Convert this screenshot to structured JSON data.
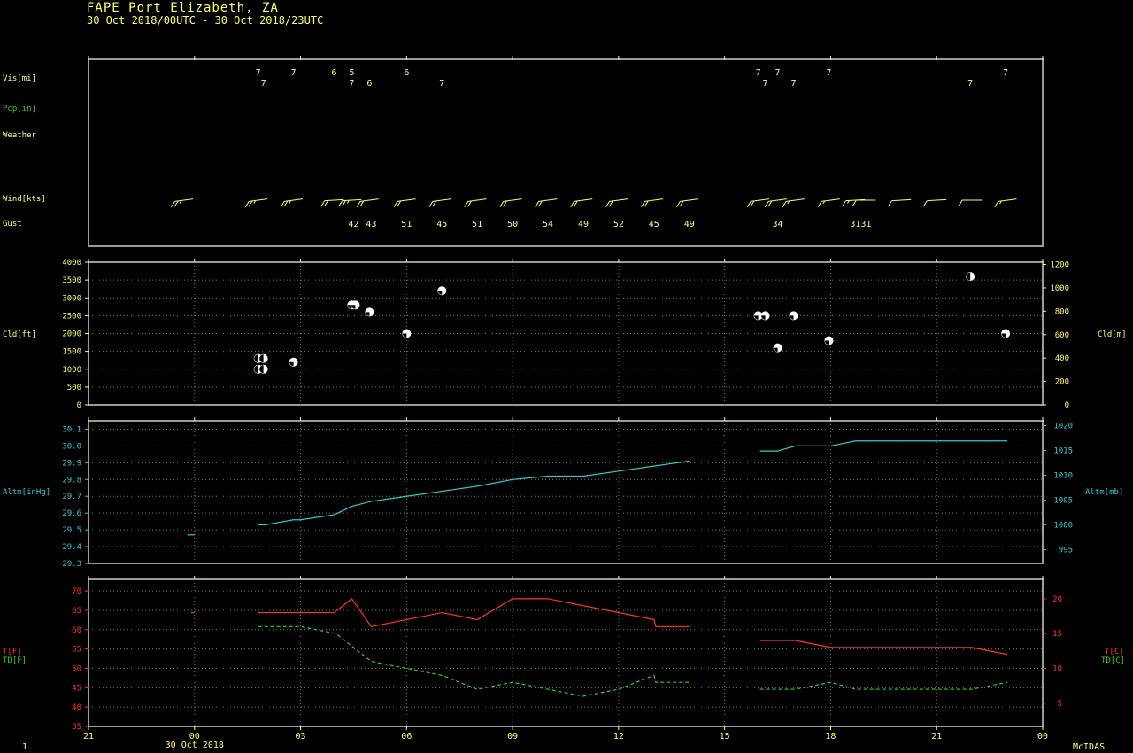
{
  "header": {
    "title": "FAPE  Port Elizabeth,  ZA",
    "subtitle": "30 Oct 2018/00UTC - 30 Oct 2018/23UTC"
  },
  "footer": {
    "left": "1",
    "right": "McIDAS"
  },
  "colors": {
    "yellow": "#ffff66",
    "cyan": "#33cccc",
    "red": "#ff3333",
    "green": "#33cc33",
    "frame": "#9a9a9a",
    "grid": "#777777"
  },
  "chart_data": [
    {
      "type": "table",
      "panel": "surface-obs",
      "row_labels": [
        "Vis[mi]",
        "Pcp[in]",
        "Weather",
        "Wind[kts]",
        "Gust"
      ],
      "visibility": [
        {
          "t": 1.8,
          "v": "7",
          "row": 0
        },
        {
          "t": 1.95,
          "v": "7",
          "row": 1
        },
        {
          "t": 2.8,
          "v": "7",
          "row": 0
        },
        {
          "t": 3.95,
          "v": "6",
          "row": 0
        },
        {
          "t": 4.45,
          "v": "5",
          "row": 0
        },
        {
          "t": 4.45,
          "v": "7",
          "row": 1
        },
        {
          "t": 4.95,
          "v": "6",
          "row": 1
        },
        {
          "t": 6.0,
          "v": "6",
          "row": 0
        },
        {
          "t": 7.0,
          "v": "7",
          "row": 1
        },
        {
          "t": 15.95,
          "v": "7",
          "row": 0
        },
        {
          "t": 16.15,
          "v": "7",
          "row": 1
        },
        {
          "t": 16.5,
          "v": "7",
          "row": 0
        },
        {
          "t": 16.95,
          "v": "7",
          "row": 1
        },
        {
          "t": 17.95,
          "v": "7",
          "row": 0
        },
        {
          "t": 21.95,
          "v": "7",
          "row": 1
        },
        {
          "t": 22.95,
          "v": "7",
          "row": 0
        }
      ],
      "wind": [
        {
          "t": -0.3,
          "dir": 250,
          "spd": 25
        },
        {
          "t": 1.8,
          "dir": 250,
          "spd": 25
        },
        {
          "t": 2.8,
          "dir": 250,
          "spd": 25
        },
        {
          "t": 3.95,
          "dir": 260,
          "spd": 20
        },
        {
          "t": 4.45,
          "dir": 260,
          "spd": 25
        },
        {
          "t": 4.95,
          "dir": 250,
          "spd": 20
        },
        {
          "t": 6.0,
          "dir": 250,
          "spd": 20
        },
        {
          "t": 7.0,
          "dir": 250,
          "spd": 20
        },
        {
          "t": 8.0,
          "dir": 250,
          "spd": 20
        },
        {
          "t": 9.0,
          "dir": 250,
          "spd": 20
        },
        {
          "t": 10.0,
          "dir": 250,
          "spd": 20
        },
        {
          "t": 11.0,
          "dir": 250,
          "spd": 20
        },
        {
          "t": 12.0,
          "dir": 250,
          "spd": 20
        },
        {
          "t": 13.0,
          "dir": 250,
          "spd": 20
        },
        {
          "t": 14.0,
          "dir": 250,
          "spd": 20
        },
        {
          "t": 16.0,
          "dir": 250,
          "spd": 20
        },
        {
          "t": 16.5,
          "dir": 250,
          "spd": 20
        },
        {
          "t": 17.0,
          "dir": 250,
          "spd": 15
        },
        {
          "t": 18.0,
          "dir": 250,
          "spd": 15
        },
        {
          "t": 18.7,
          "dir": 260,
          "spd": 15
        },
        {
          "t": 19.0,
          "dir": 270,
          "spd": 10
        },
        {
          "t": 20.0,
          "dir": 260,
          "spd": 10
        },
        {
          "t": 21.0,
          "dir": 260,
          "spd": 10
        },
        {
          "t": 22.0,
          "dir": 270,
          "spd": 10
        },
        {
          "t": 23.0,
          "dir": 250,
          "spd": 15
        }
      ],
      "gust": [
        {
          "t": 4.5,
          "v": "42"
        },
        {
          "t": 5.0,
          "v": "43"
        },
        {
          "t": 6.0,
          "v": "51"
        },
        {
          "t": 7.0,
          "v": "45"
        },
        {
          "t": 8.0,
          "v": "51"
        },
        {
          "t": 9.0,
          "v": "50"
        },
        {
          "t": 10.0,
          "v": "54"
        },
        {
          "t": 11.0,
          "v": "49"
        },
        {
          "t": 12.0,
          "v": "52"
        },
        {
          "t": 13.0,
          "v": "45"
        },
        {
          "t": 14.0,
          "v": "49"
        },
        {
          "t": 16.5,
          "v": "34"
        },
        {
          "t": 18.85,
          "v": "3131"
        }
      ]
    },
    {
      "type": "scatter",
      "panel": "cloud",
      "ylabel": "Cld[ft]",
      "ylabel_right": "Cld[m]",
      "ylim": [
        0,
        4000
      ],
      "yticks": [
        0,
        500,
        1000,
        1500,
        2000,
        2500,
        3000,
        3500,
        4000
      ],
      "yticks_right": [
        0,
        200,
        400,
        600,
        800,
        1000,
        1200
      ],
      "points": [
        {
          "t": 1.8,
          "ft": 1000,
          "cover": "broken"
        },
        {
          "t": 1.95,
          "ft": 1000,
          "cover": "broken"
        },
        {
          "t": 1.8,
          "ft": 1300,
          "cover": "broken"
        },
        {
          "t": 1.95,
          "ft": 1300,
          "cover": "broken"
        },
        {
          "t": 2.8,
          "ft": 1200,
          "cover": "scattered"
        },
        {
          "t": 4.45,
          "ft": 2800,
          "cover": "scattered"
        },
        {
          "t": 4.55,
          "ft": 2800,
          "cover": "scattered"
        },
        {
          "t": 4.95,
          "ft": 2600,
          "cover": "scattered"
        },
        {
          "t": 6.0,
          "ft": 2000,
          "cover": "scattered"
        },
        {
          "t": 7.0,
          "ft": 3200,
          "cover": "scattered"
        },
        {
          "t": 15.95,
          "ft": 2500,
          "cover": "scattered"
        },
        {
          "t": 16.15,
          "ft": 2500,
          "cover": "scattered"
        },
        {
          "t": 16.5,
          "ft": 1600,
          "cover": "scattered"
        },
        {
          "t": 16.95,
          "ft": 2500,
          "cover": "scattered"
        },
        {
          "t": 17.95,
          "ft": 1800,
          "cover": "scattered"
        },
        {
          "t": 21.95,
          "ft": 3600,
          "cover": "broken"
        },
        {
          "t": 22.95,
          "ft": 2000,
          "cover": "scattered"
        }
      ]
    },
    {
      "type": "line",
      "panel": "altimeter",
      "ylabel": "Altm[inHg]",
      "ylabel_right": "Altm[mb]",
      "ylim": [
        29.3,
        30.15
      ],
      "yticks": [
        29.3,
        29.4,
        29.5,
        29.6,
        29.7,
        29.8,
        29.9,
        30.0,
        30.1
      ],
      "yticks_right": [
        995,
        1000,
        1005,
        1010,
        1015,
        1020
      ],
      "series": [
        {
          "points": [
            [
              -0.2,
              29.47
            ],
            [
              0.0,
              29.47
            ]
          ]
        },
        {
          "points": [
            [
              1.8,
              29.53
            ],
            [
              2.0,
              29.53
            ],
            [
              2.8,
              29.56
            ],
            [
              3.0,
              29.56
            ],
            [
              3.95,
              29.59
            ],
            [
              4.45,
              29.64
            ],
            [
              5.0,
              29.67
            ],
            [
              6.0,
              29.7
            ],
            [
              7.0,
              29.73
            ],
            [
              8.0,
              29.76
            ],
            [
              9.0,
              29.8
            ],
            [
              10.0,
              29.82
            ],
            [
              11.0,
              29.82
            ],
            [
              12.0,
              29.85
            ],
            [
              13.0,
              29.88
            ],
            [
              14.0,
              29.91
            ]
          ]
        },
        {
          "points": [
            [
              16.0,
              29.97
            ],
            [
              16.5,
              29.97
            ],
            [
              17.0,
              30.0
            ],
            [
              18.0,
              30.0
            ],
            [
              18.7,
              30.03
            ],
            [
              23.0,
              30.03
            ]
          ]
        }
      ]
    },
    {
      "type": "line",
      "panel": "temperature",
      "ylabel": "T[F]",
      "ylabel2": "TD[F]",
      "ylabel_right": "T[C]",
      "ylabel_right2": "TD[C]",
      "ylim": [
        35,
        73
      ],
      "yticks": [
        35,
        40,
        45,
        50,
        55,
        60,
        65,
        70
      ],
      "yticks_right": [
        5,
        10,
        15,
        20
      ],
      "series": [
        {
          "name": "T[F]",
          "style": "solid",
          "points": [
            [
              -0.1,
              64.4
            ],
            [
              0.0,
              64.4
            ]
          ]
        },
        {
          "name": "T[F]",
          "style": "solid",
          "points": [
            [
              1.8,
              64.4
            ],
            [
              3.95,
              64.4
            ],
            [
              4.45,
              68.0
            ],
            [
              5.0,
              60.8
            ],
            [
              7.0,
              64.4
            ],
            [
              8.0,
              62.6
            ],
            [
              9.0,
              68.0
            ],
            [
              10.0,
              68.0
            ],
            [
              13.0,
              62.6
            ],
            [
              13.05,
              60.8
            ],
            [
              14.0,
              60.8
            ]
          ]
        },
        {
          "name": "T[F]",
          "style": "solid",
          "points": [
            [
              16.0,
              57.2
            ],
            [
              17.0,
              57.2
            ],
            [
              18.0,
              55.4
            ],
            [
              22.0,
              55.4
            ],
            [
              23.0,
              53.6
            ]
          ]
        },
        {
          "name": "TD[F]",
          "style": "dashed",
          "points": [
            [
              1.8,
              60.8
            ],
            [
              3.0,
              60.8
            ],
            [
              4.0,
              59.0
            ],
            [
              5.0,
              51.8
            ],
            [
              6.0,
              50.0
            ],
            [
              7.0,
              48.2
            ],
            [
              8.0,
              44.6
            ],
            [
              9.0,
              46.4
            ],
            [
              10.0,
              44.6
            ],
            [
              11.0,
              42.8
            ],
            [
              12.0,
              44.6
            ],
            [
              13.0,
              48.2
            ],
            [
              13.05,
              46.4
            ],
            [
              14.0,
              46.4
            ]
          ]
        },
        {
          "name": "TD[F]",
          "style": "dashed",
          "points": [
            [
              16.0,
              44.6
            ],
            [
              17.0,
              44.6
            ],
            [
              18.0,
              46.4
            ],
            [
              18.7,
              44.6
            ],
            [
              22.0,
              44.6
            ],
            [
              23.0,
              46.4
            ]
          ]
        }
      ],
      "xaxis": {
        "range_hours": [
          -3,
          24
        ],
        "tick_hours": [
          -3,
          0,
          3,
          6,
          9,
          12,
          15,
          18,
          21,
          24
        ],
        "tick_labels": [
          "21",
          "00",
          "03",
          "06",
          "09",
          "12",
          "15",
          "18",
          "21",
          "00"
        ],
        "date_label": "30 Oct 2018"
      }
    }
  ]
}
